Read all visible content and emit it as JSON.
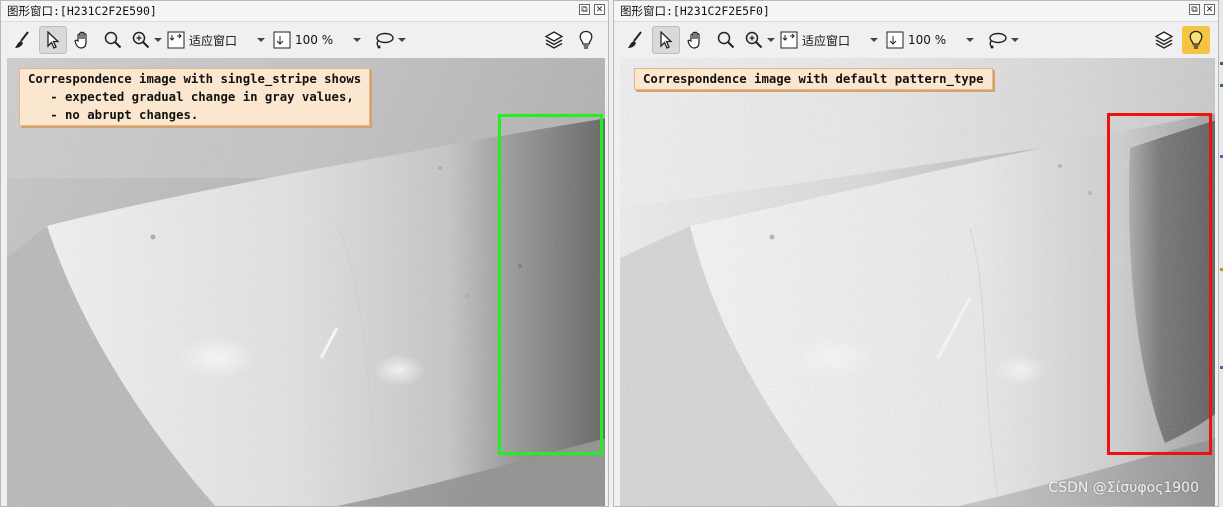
{
  "windows": [
    {
      "id": "left",
      "title": "图形窗口:[H231C2F2E590]",
      "fit_label": "适应窗口",
      "zoom_label": "100 %",
      "annotation_lines": [
        "Correspondence image with single_stripe shows",
        "   - expected gradual change in gray values,",
        "   - no abrupt changes."
      ],
      "roi_color": "#22ee22"
    },
    {
      "id": "right",
      "title": "图形窗口:[H231C2F2E5F0]",
      "fit_label": "适应窗口",
      "zoom_label": "100 %",
      "annotation_lines": [
        "Correspondence image with default pattern_type"
      ],
      "roi_color": "#ee1111"
    }
  ],
  "window_buttons": {
    "restore": "⧉",
    "close": "✕"
  },
  "icons": [
    "brush-icon",
    "pointer-icon",
    "hand-icon",
    "zoom-icon",
    "zoom-in-icon",
    "fit-window-icon",
    "zoom-level-icon",
    "lasso-icon",
    "layers-icon",
    "lightbulb-icon"
  ],
  "watermark": "CSDN @Σίσυφος1900",
  "colors": {
    "accent_lightbulb": "#f4c542",
    "annotation_bg": "#fbe7cf"
  }
}
